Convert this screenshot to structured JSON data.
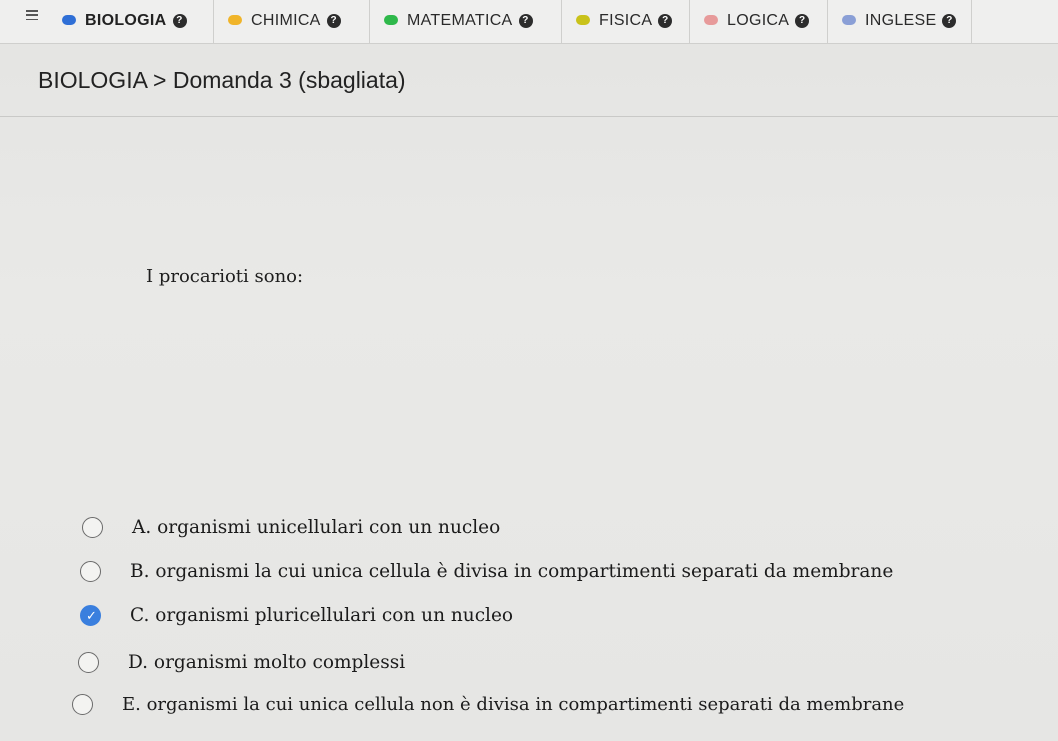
{
  "tabs": [
    {
      "label": "BIOLOGIA",
      "dot_color": "#2f6fd6",
      "active": true
    },
    {
      "label": "CHIMICA",
      "dot_color": "#f0b429"
    },
    {
      "label": "MATEMATICA",
      "dot_color": "#2eb84a"
    },
    {
      "label": "FISICA",
      "dot_color": "#c9c21a"
    },
    {
      "label": "LOGICA",
      "dot_color": "#e79a9a"
    },
    {
      "label": "INGLESE",
      "dot_color": "#8a9fd6"
    }
  ],
  "help_glyph": "?",
  "breadcrumb": "BIOLOGIA > Domanda 3 (sbagliata)",
  "question": "I procarioti sono:",
  "options": [
    {
      "text": "A. organismi unicellulari con un nucleo",
      "selected": false
    },
    {
      "text": "B. organismi la cui unica cellula è divisa in compartimenti separati da membrane",
      "selected": false
    },
    {
      "text": "C. organismi pluricellulari con un nucleo",
      "selected": true
    },
    {
      "text": "D. organismi molto complessi",
      "selected": false
    },
    {
      "text": "E. organismi la cui unica cellula non è divisa in compartimenti separati da membrane",
      "selected": false
    }
  ],
  "colors": {
    "selected_radio": "#3a7fde"
  }
}
